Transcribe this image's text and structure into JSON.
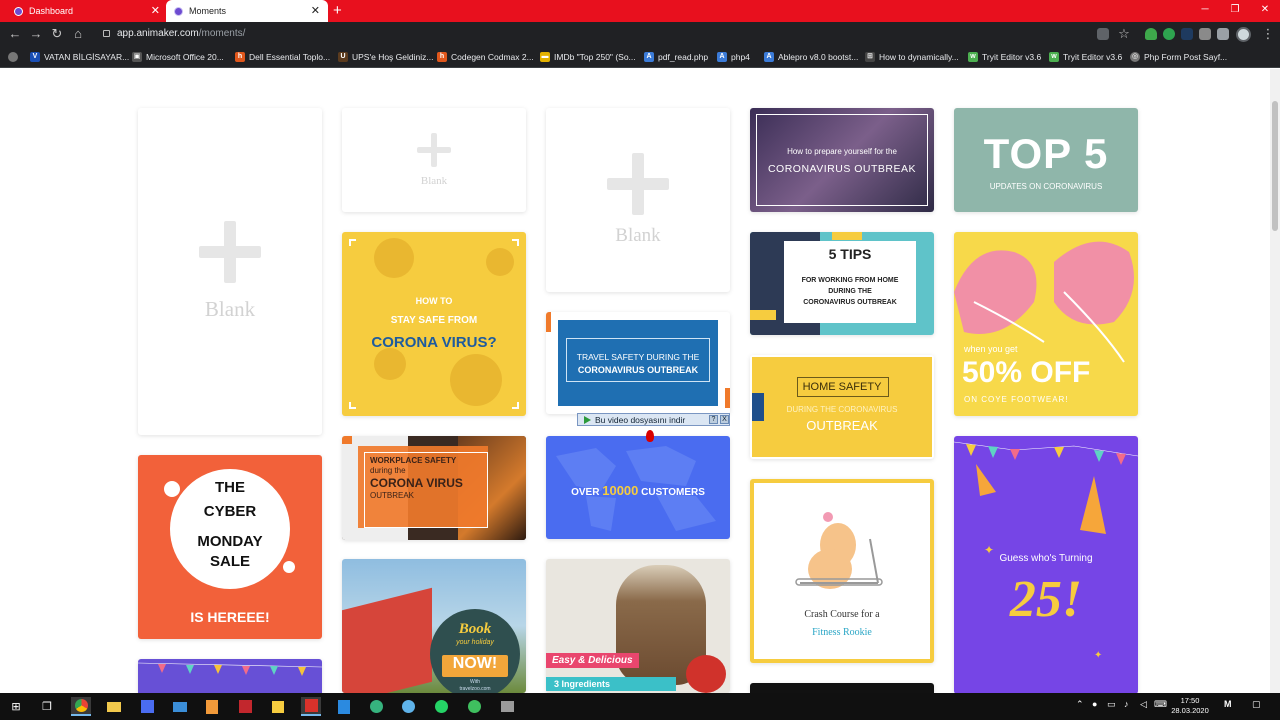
{
  "browser": {
    "tabs": [
      {
        "title": "Dashboard",
        "active": false
      },
      {
        "title": "Moments",
        "active": true
      }
    ],
    "url_host": "app.animaker.com",
    "url_path": "/moments/",
    "bookmarks": [
      {
        "label": "VATAN BİLGİSAYAR...",
        "color": "#1a4fb5",
        "glyph": "V"
      },
      {
        "label": "Microsoft Office 20...",
        "color": "#555555",
        "glyph": "▣"
      },
      {
        "label": "Dell Essential Toplo...",
        "color": "#e0571c",
        "glyph": "hb"
      },
      {
        "label": "UPS'e Hoş Geldiniz...",
        "color": "#5b3b1e",
        "glyph": "U"
      },
      {
        "label": "Codegen Codmax 2...",
        "color": "#e0571c",
        "glyph": "hb"
      },
      {
        "label": "IMDb \"Top 250\" (So...",
        "color": "#e3b100",
        "glyph": "▬"
      },
      {
        "label": "pdf_read.php",
        "color": "#3b7bd8",
        "glyph": "A"
      },
      {
        "label": "php4",
        "color": "#3b7bd8",
        "glyph": "A"
      },
      {
        "label": "Ablepro v8.0 bootst...",
        "color": "#3b7bd8",
        "glyph": "A"
      },
      {
        "label": "How to dynamically...",
        "color": "#444444",
        "glyph": "⊞"
      },
      {
        "label": "Tryit Editor v3.6",
        "color": "#4caf50",
        "glyph": "w3"
      },
      {
        "label": "Tryit Editor v3.6",
        "color": "#4caf50",
        "glyph": "w3"
      },
      {
        "label": "Php Form Post Sayf...",
        "color": "#777777",
        "glyph": "◎"
      }
    ]
  },
  "moments": {
    "blank_label": "Blank",
    "templates": {
      "corona_prepare": {
        "line1": "How to prepare yourself for the",
        "line2": "CORONAVIRUS OUTBREAK"
      },
      "top5": {
        "title": "TOP 5",
        "sub": "UPDATES ON CORONAVIRUS"
      },
      "stay_safe": {
        "line1": "HOW TO",
        "line2": "STAY SAFE FROM",
        "line3": "CORONA VIRUS?"
      },
      "travel": {
        "line1": "TRAVEL SAFETY DURING THE",
        "line2": "CORONAVIRUS OUTBREAK"
      },
      "five_tips": {
        "title": "5 TIPS",
        "line1": "FOR WORKING FROM HOME",
        "line2": "DURING THE",
        "line3": "CORONAVIRUS OUTBREAK"
      },
      "shoes": {
        "line1": "when you get",
        "line2": "50% OFF",
        "line3": "ON COYE FOOTWEAR!"
      },
      "home_safety": {
        "title": "HOME SAFETY",
        "line1": "DURING THE CORONAVIRUS",
        "line2": "OUTBREAK"
      },
      "workplace": {
        "line1": "WORKPLACE SAFETY",
        "line2": "during the",
        "line3": "CORONA VIRUS",
        "line4": "OUTBREAK"
      },
      "customers": {
        "pre": "OVER",
        "num": "10000",
        "post": "CUSTOMERS"
      },
      "cyber": {
        "line1": "THE",
        "line2": "CYBER",
        "line3": "MONDAY",
        "line4": "SALE",
        "line5": "IS HEREEE!"
      },
      "fitness": {
        "line1": "Crash Course for a",
        "line2": "Fitness Rookie"
      },
      "birthday": {
        "line1": "Guess who's Turning",
        "line2": "25!"
      },
      "holiday": {
        "line1": "Book",
        "line2": "your holiday",
        "line3": "NOW!",
        "line4": "With",
        "line5": "travelzoo.com"
      },
      "smoothie": {
        "line1": "Easy & Delicious",
        "line2": "3 Ingredients"
      }
    }
  },
  "popup": {
    "label": "Bu video dosyasını indir",
    "help": "?",
    "close": "X"
  },
  "taskbar": {
    "time": "17:50",
    "date": "28.03.2020"
  },
  "colors": {
    "chrome_red": "#e8101e",
    "animaker_purple": "#6d4bd1"
  }
}
